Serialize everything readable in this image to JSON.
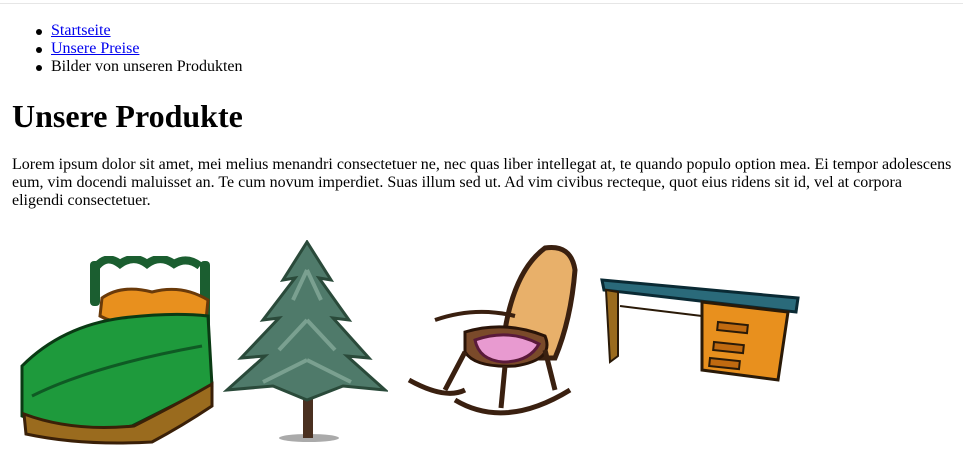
{
  "breadcrumb": {
    "items": [
      {
        "label": "Startseite"
      },
      {
        "label": "Unsere Preise"
      },
      {
        "label": "Bilder von unseren Produkten"
      }
    ]
  },
  "page": {
    "title": "Unsere Produkte",
    "intro": "Lorem ipsum dolor sit amet, mei melius menandri consectetuer ne, nec quas liber intellegat at, te quando populo option mea. Ei tempor adolescens eum, vim docendi maluisset an. Te cum novum imperdiet. Suas illum sed ut. Ad vim civibus recteque, quot eius ridens sit id, vel at corpora eligendi consectetuer."
  },
  "products": [
    {
      "name": "bed",
      "icon": "bed-icon"
    },
    {
      "name": "tree",
      "icon": "pine-tree-icon"
    },
    {
      "name": "rocking-chair",
      "icon": "rocking-chair-icon"
    },
    {
      "name": "desk",
      "icon": "desk-icon"
    }
  ],
  "colors": {
    "link": "#0000ee",
    "bed_green": "#1e9a3c",
    "bed_wood": "#9a6b1e",
    "pillow": "#e8901e",
    "tree_green": "#4f7a6a",
    "chair_wood": "#7a4a2a",
    "chair_seat": "#e8b06a",
    "cushion": "#e89ad0",
    "desk_top": "#2a6a7a",
    "desk_wood": "#e8901e"
  }
}
